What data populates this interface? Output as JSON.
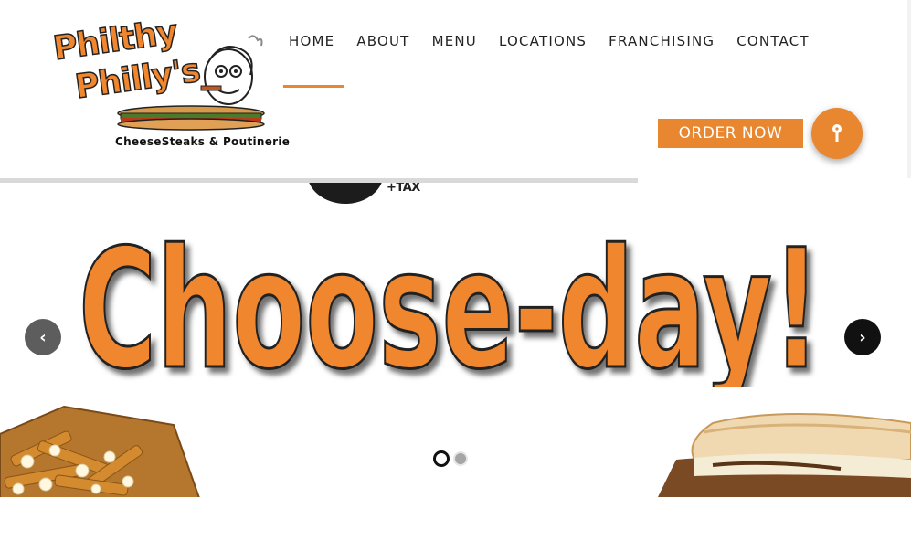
{
  "brand": {
    "logo_line1": "Philthy",
    "logo_line2": "Philly's",
    "logo_tagline": "CheeseSteaks & Poutinerie"
  },
  "nav": {
    "items": [
      {
        "label": "HOME",
        "active": true
      },
      {
        "label": "ABOUT"
      },
      {
        "label": "MENU"
      },
      {
        "label": "LOCATIONS"
      },
      {
        "label": "FRANCHISING"
      },
      {
        "label": "CONTACT"
      }
    ]
  },
  "header": {
    "order_label": "ORDER NOW",
    "key_icon": "key-icon"
  },
  "slider": {
    "headline": "Choose-day!",
    "tax_text": "+TAX",
    "prev_icon": "chevron-left-icon",
    "next_icon": "chevron-right-icon",
    "slide_count": 2,
    "active_slide": 1
  },
  "colors": {
    "accent": "#e8872f",
    "headline_fill": "#f0862d",
    "dark": "#1c1c1c"
  }
}
